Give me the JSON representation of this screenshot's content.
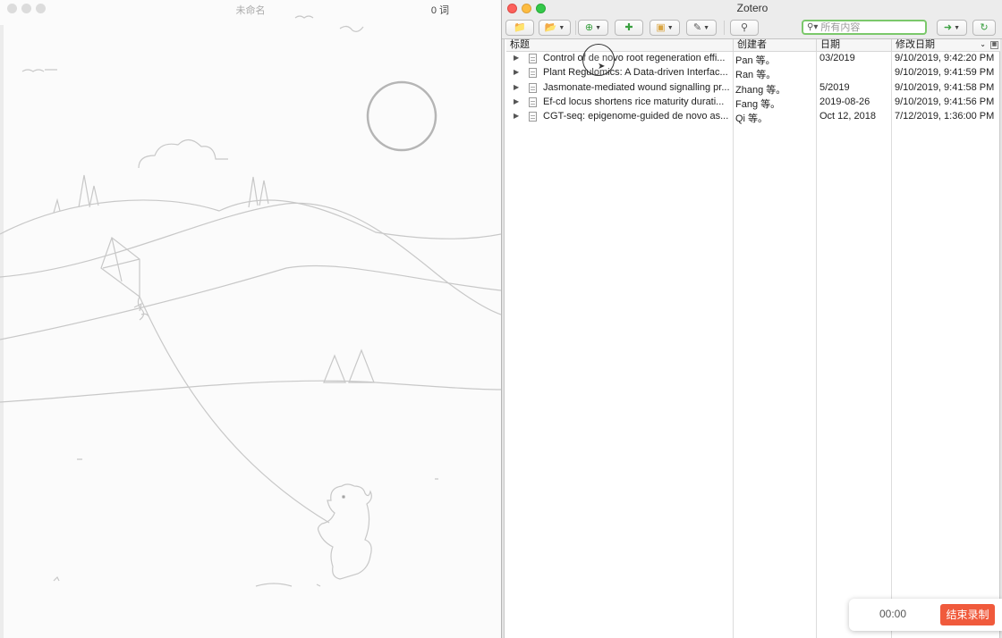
{
  "editor": {
    "title": "未命名",
    "word_count": "0 词"
  },
  "zotero": {
    "window_title": "Zotero",
    "search": {
      "placeholder": "所有内容"
    },
    "toolbar": {
      "icons": [
        "new-collection-icon",
        "new-library-icon",
        "new-item-icon",
        "add-by-identifier-icon",
        "new-note-icon",
        "attachment-icon",
        "advanced-search-icon",
        "locate-icon",
        "sync-icon"
      ]
    },
    "columns": {
      "title": "标题",
      "creator": "创建者",
      "date": "日期",
      "modified": "修改日期"
    },
    "items": [
      {
        "title": "Control of de novo root regeneration effi...",
        "creator": "Pan 等。",
        "date": "03/2019",
        "modified": "9/10/2019, 9:42:20 PM"
      },
      {
        "title": "Plant Regulomics: A Data-driven Interfac...",
        "creator": "Ran 等。",
        "date": "",
        "modified": "9/10/2019, 9:41:59 PM"
      },
      {
        "title": "Jasmonate-mediated wound signalling pr...",
        "creator": "Zhang 等。",
        "date": "5/2019",
        "modified": "9/10/2019, 9:41:58 PM"
      },
      {
        "title": "Ef-cd locus shortens rice maturity durati...",
        "creator": "Fang 等。",
        "date": "2019-08-26",
        "modified": "9/10/2019, 9:41:56 PM"
      },
      {
        "title": "CGT-seq: epigenome-guided de novo as...",
        "creator": "Qi 等。",
        "date": "Oct 12, 2018",
        "modified": "7/12/2019, 1:36:00 PM"
      }
    ]
  },
  "recorder": {
    "timer": "00:00",
    "stop_label": "结束录制",
    "stop_color": "#f05a3c"
  }
}
